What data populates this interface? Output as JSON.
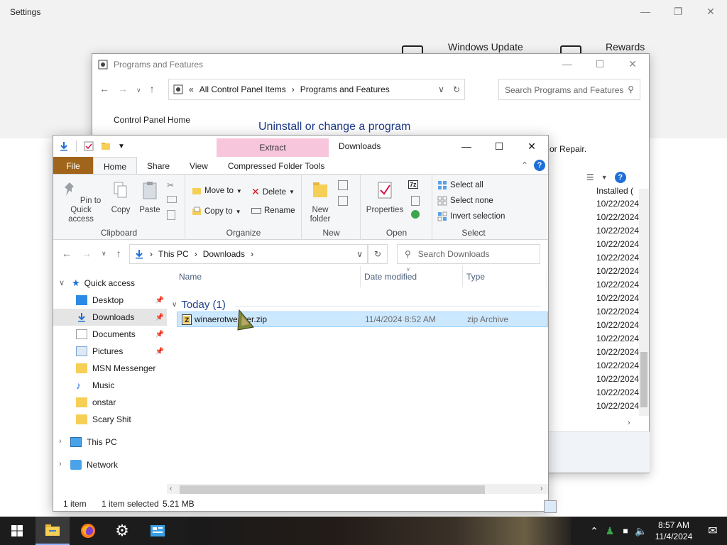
{
  "settings": {
    "title": "Settings",
    "tiles": [
      "Windows Update",
      "Rewards"
    ]
  },
  "programs_features": {
    "title": "Programs and Features",
    "address": {
      "root": "All Control Panel Items",
      "current": "Programs and Features"
    },
    "search_placeholder": "Search Programs and Features",
    "control_panel_home": "Control Panel Home",
    "heading": "Uninstall or change a program",
    "repair_fragment": "or Repair.",
    "installed_header": "Installed (",
    "installed_dates": [
      "10/22/2024",
      "10/22/2024",
      "10/22/2024",
      "10/22/2024",
      "10/22/2024",
      "10/22/2024",
      "10/22/2024",
      "10/22/2024",
      "10/22/2024",
      "10/22/2024",
      "10/22/2024",
      "10/22/2024",
      "10/22/2024",
      "10/22/2024",
      "10/22/2024",
      "10/22/2024"
    ]
  },
  "explorer": {
    "title": "Downloads",
    "context_tab": "Extract",
    "tabs": {
      "file": "File",
      "home": "Home",
      "share": "Share",
      "view": "View",
      "compressed": "Compressed Folder Tools"
    },
    "ribbon": {
      "clipboard": {
        "pin": "Pin to Quick access",
        "copy": "Copy",
        "paste": "Paste",
        "label": "Clipboard"
      },
      "organize": {
        "move_to": "Move to",
        "copy_to": "Copy to",
        "delete": "Delete",
        "rename": "Rename",
        "label": "Organize"
      },
      "new": {
        "new_folder": "New folder",
        "label": "New"
      },
      "open": {
        "properties": "Properties",
        "label": "Open"
      },
      "select": {
        "select_all": "Select all",
        "select_none": "Select none",
        "invert": "Invert selection",
        "label": "Select"
      }
    },
    "breadcrumb": {
      "pc": "This PC",
      "folder": "Downloads"
    },
    "search_placeholder": "Search Downloads",
    "nav": {
      "quick_access": "Quick access",
      "items": [
        "Desktop",
        "Downloads",
        "Documents",
        "Pictures",
        "MSN Messenger",
        "Music",
        "onstar",
        "Scary Shit"
      ],
      "this_pc": "This PC",
      "network": "Network"
    },
    "columns": {
      "name": "Name",
      "date": "Date modified",
      "type": "Type"
    },
    "group": "Today (1)",
    "files": [
      {
        "name": "winaerotweaker.zip",
        "date": "11/4/2024 8:52 AM",
        "type": "zip Archive"
      }
    ],
    "status": {
      "count": "1 item",
      "selected": "1 item selected",
      "size": "5.21 MB"
    }
  },
  "taskbar": {
    "time": "8:57 AM",
    "date": "11/4/2024"
  },
  "colors": {
    "accent": "#1e6fd9",
    "file_tab": "#a0651a",
    "extract_band": "#f7c6dd",
    "selection": "#cce8ff"
  }
}
